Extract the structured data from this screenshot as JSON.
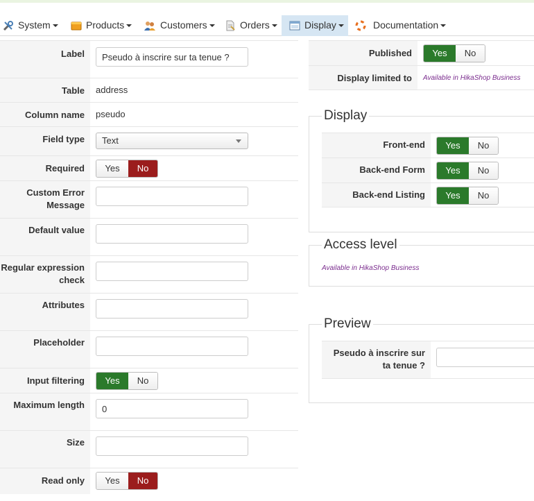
{
  "menu": {
    "items": [
      {
        "label": "System",
        "icon": "tools-icon"
      },
      {
        "label": "Products",
        "icon": "box-icon"
      },
      {
        "label": "Customers",
        "icon": "users-icon"
      },
      {
        "label": "Orders",
        "icon": "document-icon"
      },
      {
        "label": "Display",
        "icon": "display-icon",
        "active": true
      },
      {
        "label": "Documentation",
        "icon": "lifebuoy-icon"
      }
    ]
  },
  "form": {
    "label": {
      "label": "Label",
      "value": "Pseudo à inscrire sur ta tenue ?"
    },
    "table": {
      "label": "Table",
      "value": "address"
    },
    "column_name": {
      "label": "Column name",
      "value": "pseudo"
    },
    "field_type": {
      "label": "Field type",
      "value": "Text"
    },
    "required": {
      "label": "Required",
      "yes": "Yes",
      "no": "No",
      "selected": "No"
    },
    "custom_error": {
      "label_line1": "Custom Error",
      "label_line2": "Message",
      "value": ""
    },
    "default_value": {
      "label": "Default value",
      "value": ""
    },
    "regex": {
      "label_line1": "Regular expression",
      "label_line2": "check",
      "value": ""
    },
    "attributes": {
      "label": "Attributes",
      "value": ""
    },
    "placeholder": {
      "label": "Placeholder",
      "value": ""
    },
    "input_filtering": {
      "label": "Input filtering",
      "yes": "Yes",
      "no": "No",
      "selected": "Yes"
    },
    "maximum_length": {
      "label": "Maximum length",
      "value": "0"
    },
    "size": {
      "label": "Size",
      "value": ""
    },
    "read_only": {
      "label": "Read only",
      "yes": "Yes",
      "no": "No",
      "selected": "No"
    }
  },
  "right": {
    "published": {
      "label": "Published",
      "yes": "Yes",
      "no": "No",
      "selected": "Yes"
    },
    "display_limited": {
      "label": "Display limited to",
      "note": "Available in HikaShop Business"
    }
  },
  "display": {
    "legend": "Display",
    "front_end": {
      "label": "Front-end",
      "yes": "Yes",
      "no": "No",
      "selected": "Yes"
    },
    "back_end_form": {
      "label": "Back-end Form",
      "yes": "Yes",
      "no": "No",
      "selected": "Yes"
    },
    "back_end_listing": {
      "label": "Back-end Listing",
      "yes": "Yes",
      "no": "No",
      "selected": "Yes"
    }
  },
  "access": {
    "legend": "Access level",
    "note": "Available in HikaShop Business"
  },
  "preview": {
    "legend": "Preview",
    "label_line1": "Pseudo à inscrire sur",
    "label_line2": "ta tenue ?",
    "value": ""
  },
  "colors": {
    "yes_active": "#2b7a2b",
    "no_active": "#9b1d1d",
    "menu_active": "#d6e6f3",
    "note": "#7b2d8e"
  }
}
